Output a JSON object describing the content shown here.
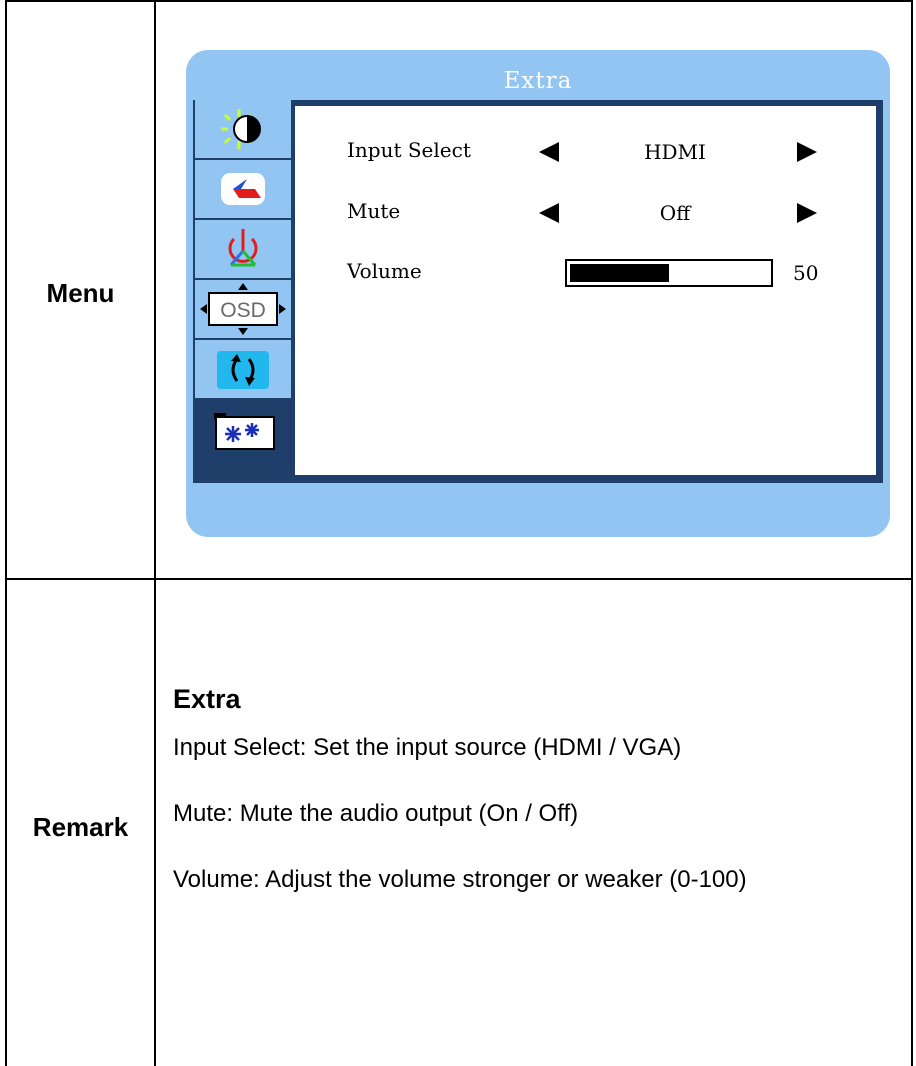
{
  "table": {
    "menu_label": "Menu",
    "remark_label": "Remark"
  },
  "osd": {
    "title": "Extra",
    "panel_color": "#92c5f2",
    "frame_color": "#1f3e6a",
    "tabs": [
      {
        "icon": "brightness-contrast-icon",
        "selected": false
      },
      {
        "icon": "image-adjust-icon",
        "selected": false
      },
      {
        "icon": "color-icon",
        "selected": false
      },
      {
        "icon": "osd-position-icon",
        "selected": false,
        "label": "OSD"
      },
      {
        "icon": "reset-icon",
        "selected": false
      },
      {
        "icon": "extra-settings-icon",
        "selected": true
      }
    ],
    "input_select": {
      "label": "Input Select",
      "value": "HDMI"
    },
    "mute": {
      "label": "Mute",
      "value": "Off"
    },
    "volume": {
      "label": "Volume",
      "value": "50",
      "level_percent": 50
    }
  },
  "remark": {
    "title": "Extra",
    "lines": [
      "Input Select: Set the input source (HDMI / VGA)",
      "Mute: Mute the audio output (On / Off)",
      "Volume: Adjust the volume stronger or weaker (0-100)"
    ]
  }
}
